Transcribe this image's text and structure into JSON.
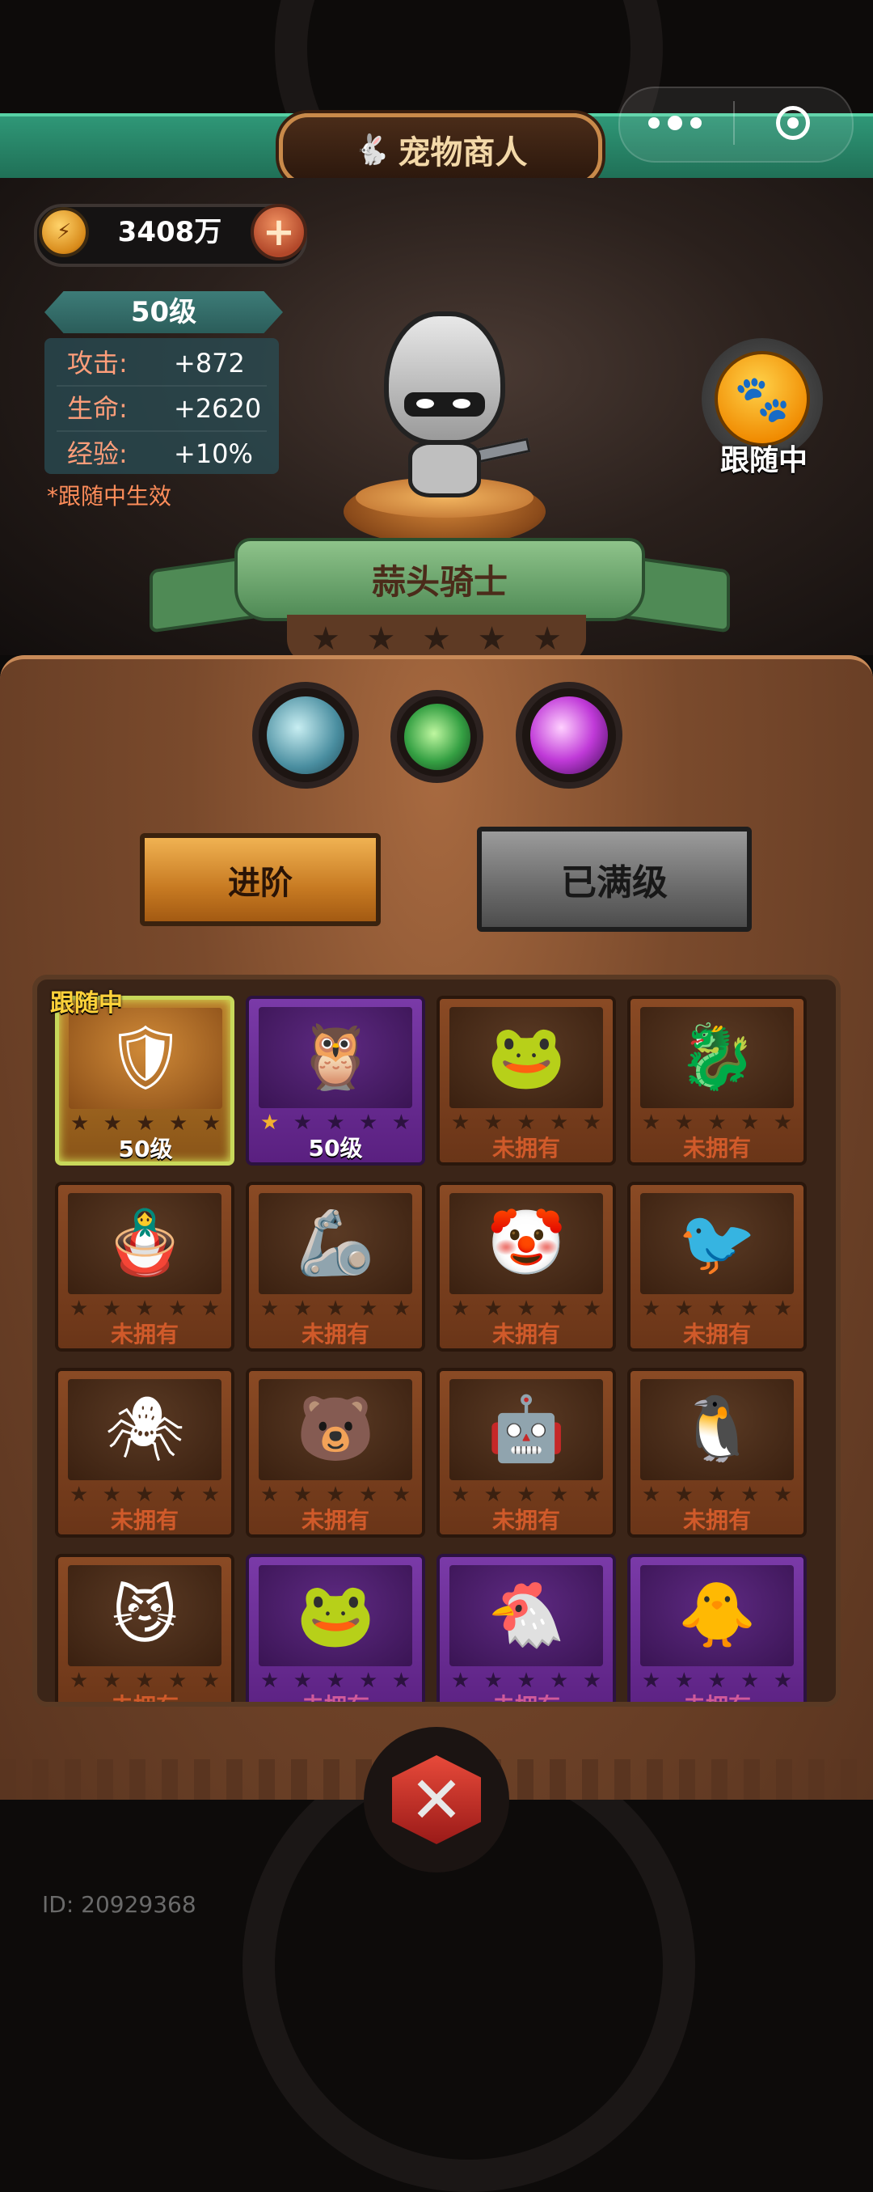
{
  "header": {
    "title": "宠物商人",
    "more_icon": "more-dots-icon",
    "close_icon": "target-close-icon"
  },
  "currency": {
    "icon": "gold-coin-icon",
    "value": "3408万",
    "add_label": "+"
  },
  "pet": {
    "level": "50级",
    "stats": [
      {
        "label": "攻击:",
        "value": "+872"
      },
      {
        "label": "生命:",
        "value": "+2620"
      },
      {
        "label": "经验:",
        "value": "+10%"
      }
    ],
    "note": "*跟随中生效",
    "name": "蒜头骑士",
    "stars_filled": 0,
    "stars_total": 5,
    "follow_status": "跟随中",
    "follow_icon": "paw-icon"
  },
  "skills": [
    {
      "name": "skill-ice-hammer-icon"
    },
    {
      "name": "skill-green-claw-icon"
    },
    {
      "name": "skill-purple-chat-icon"
    }
  ],
  "actions": {
    "advance_label": "进阶",
    "max_label": "已满级"
  },
  "grid": {
    "following_tag": "跟随中",
    "cards": [
      {
        "glyph": "🛡",
        "level": "50级",
        "owned": true,
        "theme": "active",
        "stars": 0
      },
      {
        "glyph": "🦉",
        "level": "50级",
        "owned": true,
        "theme": "purple",
        "stars": 1
      },
      {
        "glyph": "🐸",
        "level": "未拥有",
        "owned": false,
        "theme": "brown",
        "stars": 0
      },
      {
        "glyph": "🐉",
        "level": "未拥有",
        "owned": false,
        "theme": "brown",
        "stars": 0
      },
      {
        "glyph": "🪆",
        "level": "未拥有",
        "owned": false,
        "theme": "brown",
        "stars": 0
      },
      {
        "glyph": "🦾",
        "level": "未拥有",
        "owned": false,
        "theme": "brown",
        "stars": 0
      },
      {
        "glyph": "🤡",
        "level": "未拥有",
        "owned": false,
        "theme": "brown",
        "stars": 0
      },
      {
        "glyph": "🐦",
        "level": "未拥有",
        "owned": false,
        "theme": "brown",
        "stars": 0
      },
      {
        "glyph": "🕷",
        "level": "未拥有",
        "owned": false,
        "theme": "brown",
        "stars": 0
      },
      {
        "glyph": "🐻",
        "level": "未拥有",
        "owned": false,
        "theme": "brown",
        "stars": 0
      },
      {
        "glyph": "🤖",
        "level": "未拥有",
        "owned": false,
        "theme": "brown",
        "stars": 0
      },
      {
        "glyph": "🐧",
        "level": "未拥有",
        "owned": false,
        "theme": "brown",
        "stars": 0
      },
      {
        "glyph": "😼",
        "level": "未拥有",
        "owned": false,
        "theme": "brown",
        "stars": 0
      },
      {
        "glyph": "🐸",
        "level": "未拥有",
        "owned": false,
        "theme": "purple",
        "stars": 0
      },
      {
        "glyph": "🐔",
        "level": "未拥有",
        "owned": false,
        "theme": "purple",
        "stars": 0
      },
      {
        "glyph": "🐥",
        "level": "未拥有",
        "owned": false,
        "theme": "purple",
        "stars": 0
      }
    ]
  },
  "bottom": {
    "emblem_icon": "crossed-swords-emblem-icon",
    "emblem_glyph": "✕"
  },
  "footer": {
    "id_text": "ID: 20929368"
  },
  "colors": {
    "accent_green": "#2f9777",
    "panel_brown": "#7a4a2c",
    "gold": "#f2b030",
    "unowned_text": "#d05a2a"
  }
}
